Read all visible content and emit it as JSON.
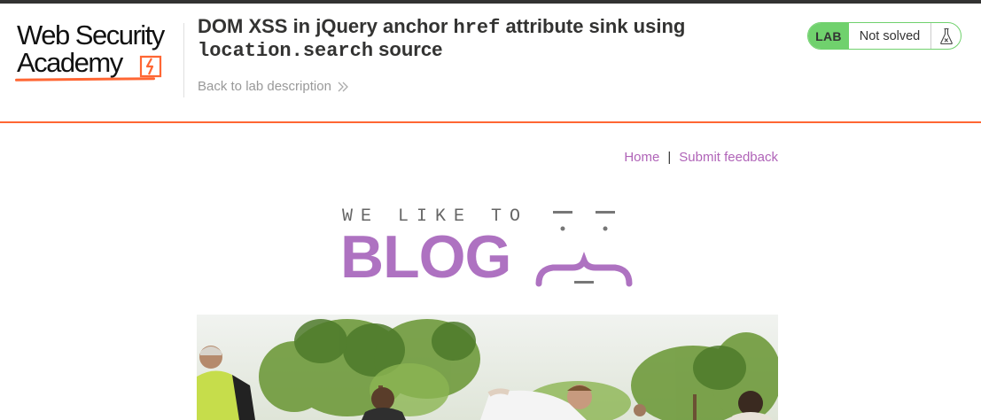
{
  "header": {
    "logo": {
      "line1": "Web Security",
      "line2": "Academy"
    },
    "lab_title_parts": {
      "t1": "DOM XSS in jQuery anchor ",
      "code1": "href",
      "t2": " attribute sink using",
      "code2": "location.search",
      "t3": " source"
    },
    "back_link": "Back to lab description",
    "status": {
      "badge": "LAB",
      "state": "Not solved",
      "icon": "flask-icon"
    }
  },
  "nav": {
    "home": "Home",
    "separator": "|",
    "feedback": "Submit feedback"
  },
  "blog_logo": {
    "tagline": "WE LIKE TO",
    "word": "BLOG"
  },
  "hero": {
    "image": "people-planting-trees-photo"
  },
  "colors": {
    "accent": "#ff6633",
    "link": "#b064b8",
    "blog": "#ae72c1",
    "lab_green": "#70d16d"
  }
}
